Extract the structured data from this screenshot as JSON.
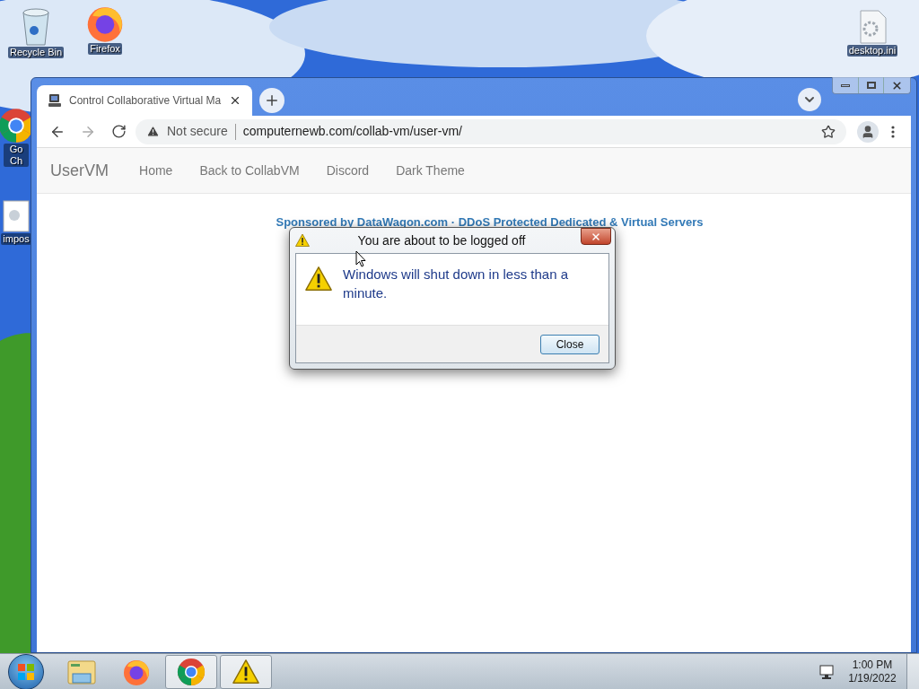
{
  "desktop": {
    "icons": [
      {
        "label": "Recycle Bin",
        "kind": "recycle"
      },
      {
        "label": "Firefox",
        "kind": "firefox"
      },
      {
        "label": "Go Ch",
        "kind": "chrome"
      },
      {
        "label": "impos",
        "kind": "file"
      },
      {
        "label": "desktop.ini",
        "kind": "settings_file"
      }
    ]
  },
  "browser": {
    "tabs": [
      {
        "title": "Control Collaborative Virtual Ma",
        "selected": true
      }
    ],
    "address_bar": {
      "security": "Not secure",
      "url": "computernewb.com/collab-vm/user-vm/"
    }
  },
  "page": {
    "brand": "UserVM",
    "nav": [
      "Home",
      "Back to CollabVM",
      "Discord",
      "Dark Theme"
    ],
    "sponsor": "Sponsored by DataWagon.com · DDoS Protected Dedicated & Virtual Servers"
  },
  "dialog": {
    "title": "You are about to be logged off",
    "message": "Windows will shut down in less than a minute.",
    "buttons": [
      "Close"
    ]
  },
  "taskbar": {
    "items": [
      {
        "kind": "explorer",
        "running": false
      },
      {
        "kind": "firefox",
        "running": false
      },
      {
        "kind": "chrome",
        "running": true
      },
      {
        "kind": "warning",
        "running": true
      }
    ],
    "time": "1:00 PM",
    "date": "1/19/2022"
  }
}
